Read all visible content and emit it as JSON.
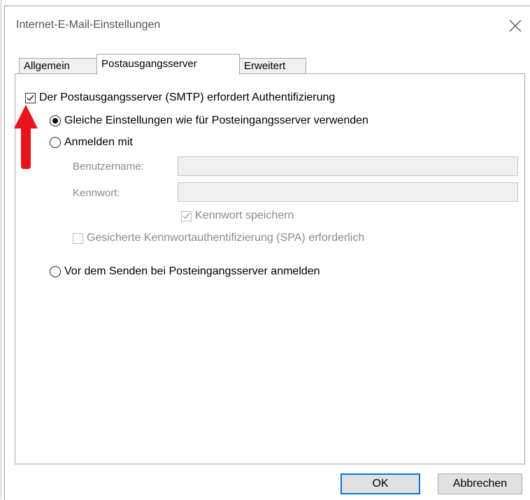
{
  "dialog": {
    "title": "Internet-E-Mail-Einstellungen",
    "close_icon": "close-icon"
  },
  "tabs": [
    {
      "label": "Allgemein",
      "active": false
    },
    {
      "label": "Postausgangsserver",
      "active": true
    },
    {
      "label": "Erweitert",
      "active": false
    }
  ],
  "smtp_auth": {
    "label": "Der Postausgangsserver (SMTP) erfordert Authentifizierung",
    "checked": true
  },
  "options": {
    "same_settings": {
      "label": "Gleiche Einstellungen wie für Posteingangsserver verwenden",
      "selected": true
    },
    "login_with": {
      "label": "Anmelden mit",
      "selected": false
    },
    "login_before_send": {
      "label": "Vor dem Senden bei Posteingangsserver anmelden",
      "selected": false
    }
  },
  "credentials": {
    "username_label": "Benutzername:",
    "username_value": "",
    "password_label": "Kennwort:",
    "password_value": "",
    "remember_password": {
      "label": "Kennwort speichern",
      "checked": true,
      "disabled": true
    },
    "spa": {
      "label": "Gesicherte Kennwortauthentifizierung (SPA) erforderlich",
      "checked": false,
      "disabled": true
    }
  },
  "buttons": {
    "ok": "OK",
    "cancel": "Abbrechen"
  },
  "colors": {
    "arrow": "#e8141b",
    "default_button_border": "#0078d7",
    "disabled_text": "#8c8c8c"
  }
}
